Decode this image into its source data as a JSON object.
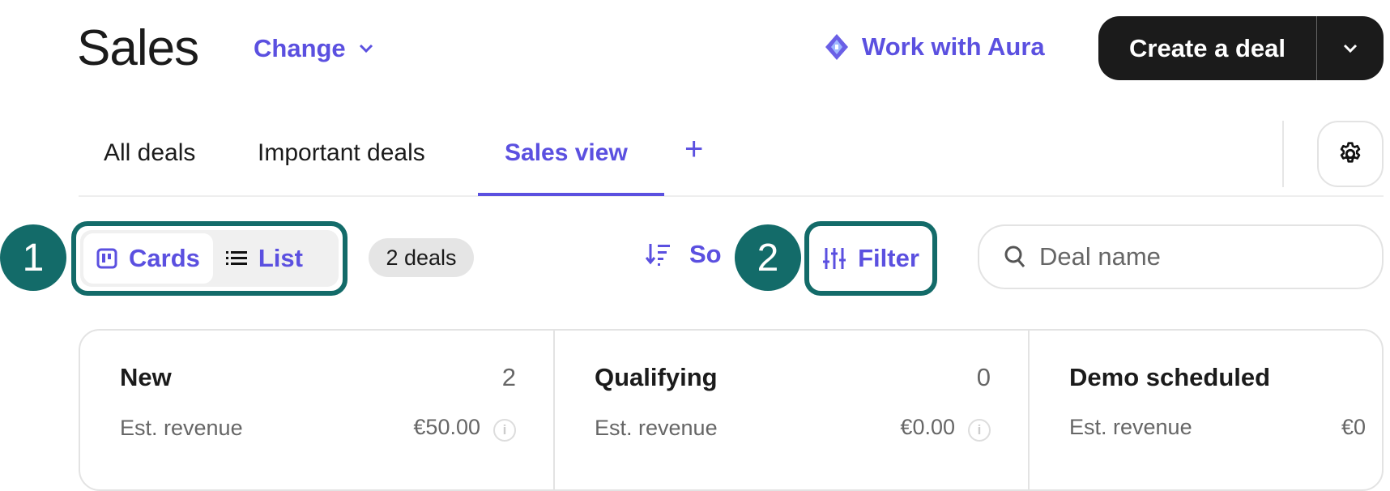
{
  "header": {
    "title": "Sales",
    "change_label": "Change",
    "aura_label": "Work with Aura",
    "create_label": "Create a deal"
  },
  "tabs": [
    {
      "label": "All deals"
    },
    {
      "label": "Important deals"
    },
    {
      "label": "Sales view",
      "active": true
    }
  ],
  "toolbar": {
    "view_options": [
      {
        "label": "Cards",
        "active": true
      },
      {
        "label": "List"
      }
    ],
    "deal_count": "2 deals",
    "sort_label": "So",
    "filter_label": "Filter",
    "search_placeholder": "Deal name"
  },
  "annotations": [
    "1",
    "2"
  ],
  "columns": [
    {
      "name": "New",
      "count": "2",
      "revenue_label": "Est. revenue",
      "revenue": "€50.00"
    },
    {
      "name": "Qualifying",
      "count": "0",
      "revenue_label": "Est. revenue",
      "revenue": "€0.00"
    },
    {
      "name": "Demo scheduled",
      "count": "",
      "revenue_label": "Est. revenue",
      "revenue": "€0"
    }
  ],
  "colors": {
    "accent": "#5b50e0",
    "annotation": "#136b69",
    "primary_button": "#1b1b1b"
  }
}
